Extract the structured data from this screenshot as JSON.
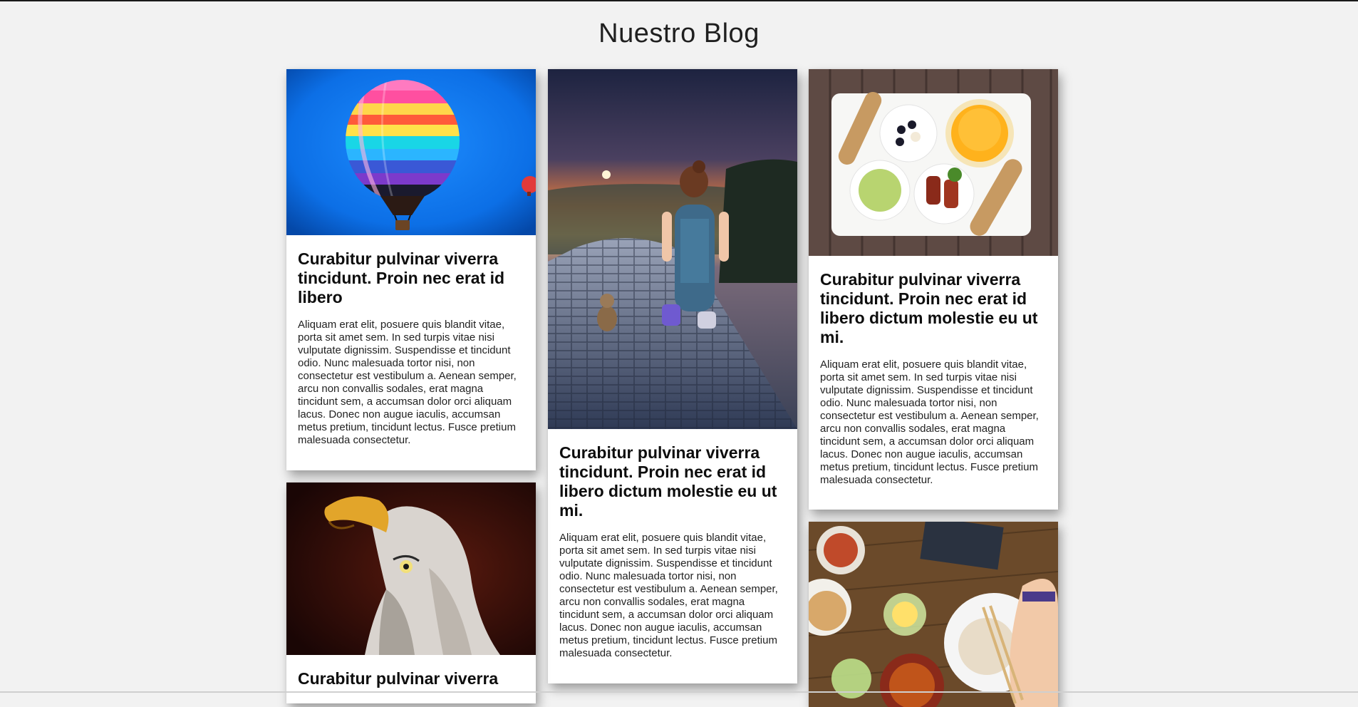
{
  "header": {
    "title": "Nuestro Blog"
  },
  "posts": [
    {
      "title": "Curabitur pulvinar viverra tincidunt. Proin nec erat id libero",
      "excerpt": "Aliquam erat elit, posuere quis blandit vitae, porta sit amet sem. In sed turpis vitae nisi vulputate dignissim. Suspendisse et tincidunt odio. Nunc malesuada tortor nisi, non consectetur est vestibulum a. Aenean semper, arcu non convallis sodales, erat magna tincidunt sem, a accumsan dolor orci aliquam lacus. Donec non augue iaculis, accumsan metus pretium, tincidunt lectus. Fusce pretium malesuada consectetur.",
      "image": "hot-air-balloon"
    },
    {
      "title": "Curabitur pulvinar viverra tincidunt. Proin nec erat id libero dictum molestie eu ut mi.",
      "excerpt": "Aliquam erat elit, posuere quis blandit vitae, porta sit amet sem. In sed turpis vitae nisi vulputate dignissim. Suspendisse et tincidunt odio. Nunc malesuada tortor nisi, non consectetur est vestibulum a. Aenean semper, arcu non convallis sodales, erat magna tincidunt sem, a accumsan dolor orci aliquam lacus. Donec non augue iaculis, accumsan metus pretium, tincidunt lectus. Fusce pretium malesuada consectetur.",
      "image": "child-on-road-sunset"
    },
    {
      "title": "Curabitur pulvinar viverra tincidunt. Proin nec erat id libero dictum molestie eu ut mi.",
      "excerpt": "Aliquam erat elit, posuere quis blandit vitae, porta sit amet sem. In sed turpis vitae nisi vulputate dignissim. Suspendisse et tincidunt odio. Nunc malesuada tortor nisi, non consectetur est vestibulum a. Aenean semper, arcu non convallis sodales, erat magna tincidunt sem, a accumsan dolor orci aliquam lacus. Donec non augue iaculis, accumsan metus pretium, tincidunt lectus. Fusce pretium malesuada consectetur.",
      "image": "breakfast-plate"
    },
    {
      "title": "Curabitur pulvinar viverra",
      "excerpt": "",
      "image": "eagle"
    },
    {
      "title": "",
      "excerpt": "",
      "image": "dinner-table"
    }
  ]
}
